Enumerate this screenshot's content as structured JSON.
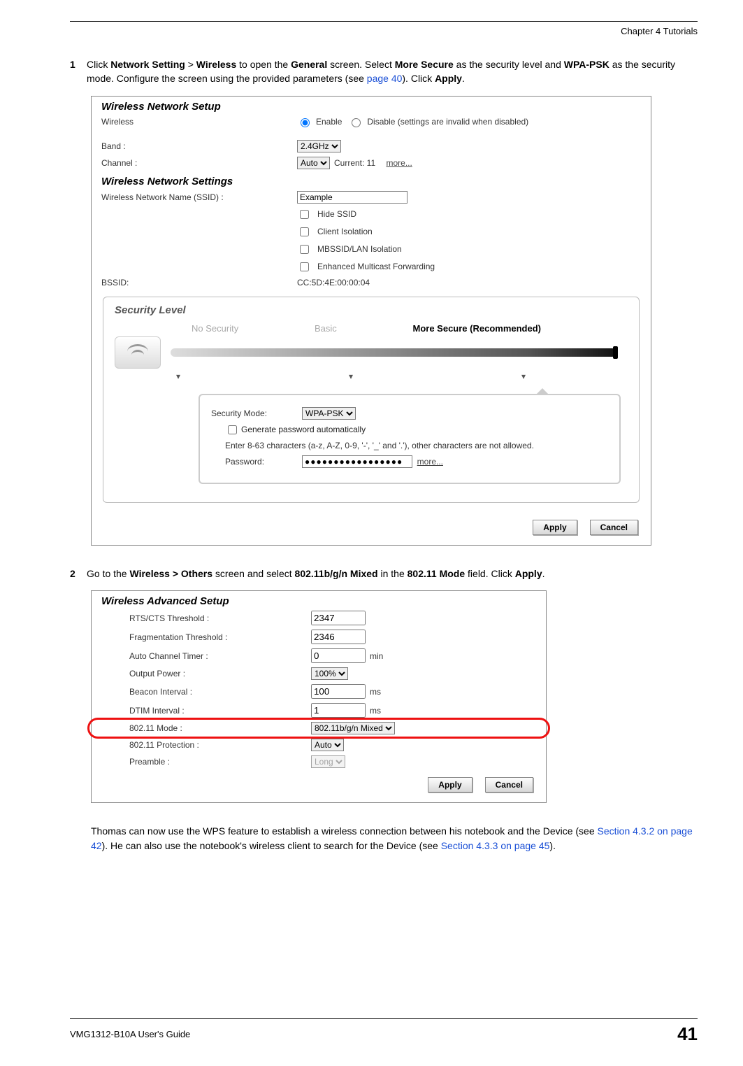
{
  "header": {
    "chapter": "Chapter 4 Tutorials"
  },
  "step1": {
    "num": "1",
    "t1": "Click ",
    "b1": "Network Setting",
    "sep1": " > ",
    "b2": "Wireless",
    "t2": " to open the ",
    "b3": "General",
    "t3": " screen. Select ",
    "b4": "More Secure",
    "t4": " as the security level and ",
    "b5": "WPA-PSK",
    "t5": " as the security mode. Configure the screen using the provided parameters (see ",
    "link": "page 40",
    "t6": "). Click ",
    "b6": "Apply",
    "t7": "."
  },
  "fig1": {
    "title1": "Wireless Network Setup",
    "wireless_lbl": "Wireless",
    "enable": "Enable",
    "disable": "Disable (settings are invalid when disabled)",
    "band_lbl": "Band :",
    "band_val": "2.4GHz",
    "channel_lbl": "Channel :",
    "channel_val": "Auto",
    "channel_cur": "Current: 11",
    "more": "more...",
    "title2": "Wireless Network Settings",
    "ssid_lbl": "Wireless Network Name (SSID) :",
    "ssid_val": "Example",
    "hide_ssid": "Hide SSID",
    "client_iso": "Client Isolation",
    "mbssid": "MBSSID/LAN Isolation",
    "emf": "Enhanced Multicast Forwarding",
    "bssid_lbl": "BSSID:",
    "bssid_val": "CC:5D:4E:00:00:04",
    "sec_title": "Security Level",
    "lvl_no": "No Security",
    "lvl_basic": "Basic",
    "lvl_more": "More Secure (Recommended)",
    "secmode_lbl": "Security Mode:",
    "secmode_val": "WPA-PSK",
    "genpw": "Generate password automatically",
    "pwnote": "Enter 8-63 characters (a-z, A-Z, 0-9, '-', '_' and '.'), other characters are not allowed.",
    "pw_lbl": "Password:",
    "pw_val": "●●●●●●●●●●●●●●●●●",
    "apply": "Apply",
    "cancel": "Cancel"
  },
  "step2": {
    "num": "2",
    "t1": "Go to the ",
    "b1": "Wireless > Others",
    "t2": " screen and select ",
    "b2": "802.11b/g/n Mixed",
    "t3": " in the ",
    "b3": "802.11 Mode",
    "t4": " field. Click ",
    "b4": "Apply",
    "t5": "."
  },
  "fig2": {
    "title": "Wireless Advanced Setup",
    "rows": {
      "rts_lbl": "RTS/CTS Threshold :",
      "rts_val": "2347",
      "frag_lbl": "Fragmentation Threshold :",
      "frag_val": "2346",
      "act_lbl": "Auto Channel Timer :",
      "act_val": "0",
      "act_u": "min",
      "out_lbl": "Output Power :",
      "out_val": "100%",
      "bi_lbl": "Beacon Interval :",
      "bi_val": "100",
      "bi_u": "ms",
      "dt_lbl": "DTIM Interval :",
      "dt_val": "1",
      "dt_u": "ms",
      "mode_lbl": "802.11 Mode :",
      "mode_val": "802.11b/g/n Mixed",
      "prot_lbl": "802.11 Protection :",
      "prot_val": "Auto",
      "pre_lbl": "Preamble :",
      "pre_val": "Long"
    },
    "apply": "Apply",
    "cancel": "Cancel"
  },
  "closing": {
    "t1": "Thomas can now use the WPS feature to establish a wireless connection between his notebook and the Device (see ",
    "link1": "Section 4.3.2 on page 42",
    "t2": "). He can also use the notebook's wireless client to search for the Device (see ",
    "link2": "Section 4.3.3 on page 45",
    "t3": ")."
  },
  "footer": {
    "guide": "VMG1312-B10A User's Guide",
    "page": "41"
  }
}
